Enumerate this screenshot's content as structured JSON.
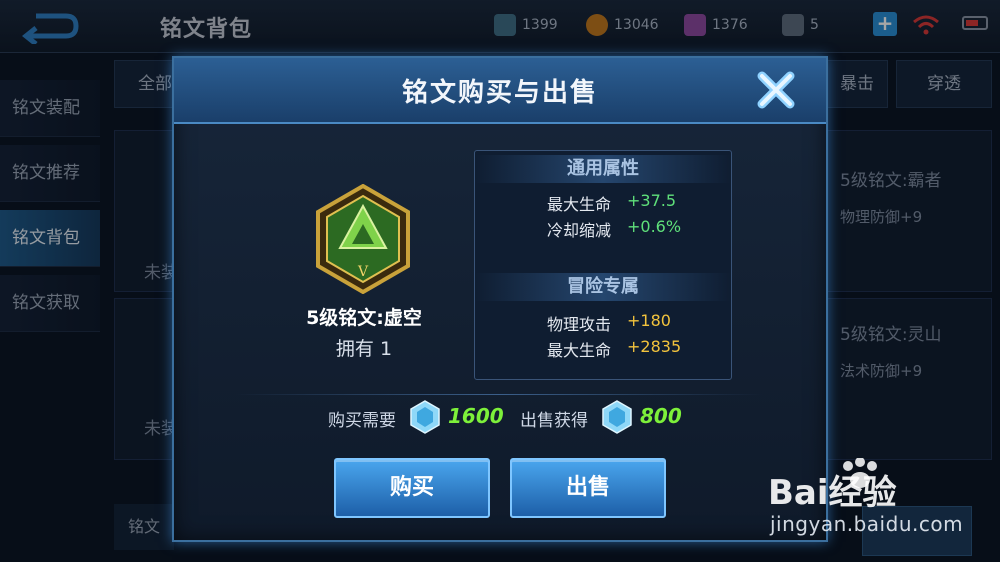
{
  "background": {
    "screen_title": "铭文背包",
    "currencies": [
      {
        "icon": "diamond-icon",
        "value": "1399",
        "color": "#5f8fa8"
      },
      {
        "icon": "gold-coin-icon",
        "value": "13046",
        "color": "#d88a2a"
      },
      {
        "icon": "rune-fragment-icon",
        "value": "1376",
        "color": "#b45cc8"
      },
      {
        "icon": "voucher-icon",
        "value": "5",
        "color": "#8a9aad"
      }
    ],
    "side_nav": [
      "铭文装配",
      "铭文推荐",
      "铭文背包",
      "铭文获取"
    ],
    "side_nav_active_index": 2,
    "filter_tabs": [
      "全部",
      "暴击",
      "穿透"
    ],
    "cards": [
      {
        "name": "5级铭文:霸者",
        "stat": "物理防御+9",
        "status": "未装"
      },
      {
        "name": "5级铭文:灵山",
        "stat": "法术防御+9",
        "status": "未装"
      }
    ],
    "bottom_left_label": "铭文"
  },
  "dialog": {
    "title": "铭文购买与出售",
    "rune": {
      "name": "5级铭文:虚空",
      "owned": "拥有 1",
      "level_mark": "V",
      "color": "#5bbf3a"
    },
    "sections": [
      {
        "heading": "通用属性",
        "rows": [
          {
            "label": "最大生命",
            "value": "+37.5",
            "tone": "green"
          },
          {
            "label": "冷却缩减",
            "value": "+0.6%",
            "tone": "green"
          }
        ]
      },
      {
        "heading": "冒险专属",
        "rows": [
          {
            "label": "物理攻击",
            "value": "+180",
            "tone": "yellow"
          },
          {
            "label": "最大生命",
            "value": "+2835",
            "tone": "yellow"
          }
        ]
      }
    ],
    "buy_price_label": "购买需要",
    "buy_price": "1600",
    "sell_price_label": "出售获得",
    "sell_price": "800",
    "buy_button": "购买",
    "sell_button": "出售"
  },
  "watermark": {
    "logo_text": "Bai经验",
    "url": "jingyan.baidu.com"
  }
}
